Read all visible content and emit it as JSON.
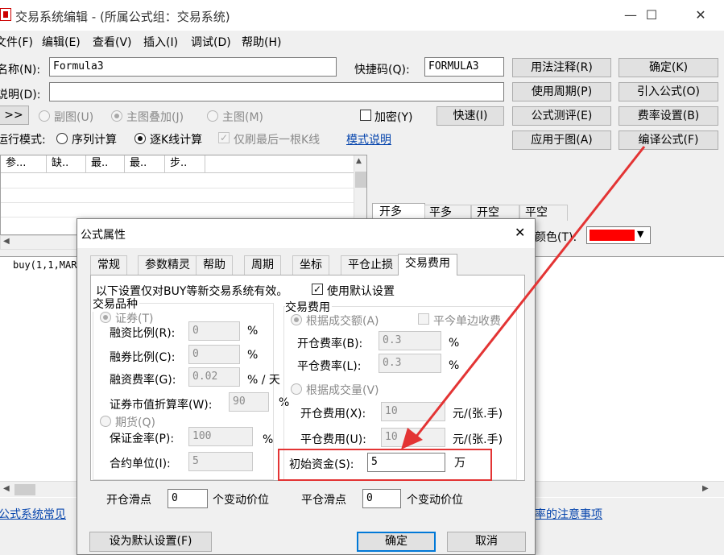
{
  "window": {
    "title": "交易系统编辑 - (所属公式组：交易系统)",
    "minimize": "—",
    "maximize": "☐",
    "close": "✕"
  },
  "menu": [
    "文件(F)",
    "编辑(E)",
    "查看(V)",
    "插入(I)",
    "调试(D)",
    "帮助(H)"
  ],
  "form": {
    "name_label": "名称(N):",
    "name_value": "Formula3",
    "shortcut_label": "快捷码(Q):",
    "shortcut_value": "FORMULA3",
    "desc_label": "说明(D):",
    "desc_value": "",
    "expand_btn": ">>",
    "sub_chart": "副图(U)",
    "main_overlay": "主图叠加(J)",
    "main_chart": "主图(M)",
    "encrypt": "加密(Y)",
    "quick_btn": "快速(I)",
    "run_mode_label": "运行模式:",
    "mode_seq": "序列计算",
    "mode_kline": "逐K线计算",
    "mode_last": "仅刷最后一根K线",
    "mode_help_link": "模式说明"
  },
  "side_buttons": {
    "usage_notes": "用法注释(R)",
    "ok": "确定(K)",
    "usage_period": "使用周期(P)",
    "import_formula": "引入公式(O)",
    "formula_eval": "公式测评(E)",
    "fee_settings": "费率设置(B)",
    "apply_chart": "应用于图(A)",
    "compile": "编译公式(F)"
  },
  "param_grid": {
    "columns": [
      "参...",
      "缺..",
      "最..",
      "最..",
      "步.."
    ]
  },
  "signal_tabs": [
    "开多",
    "平多",
    "开空",
    "平空"
  ],
  "color_label": "颜色(T):",
  "color_value": "#ff0000",
  "editor": {
    "code": "buy(1,1,MAR"
  },
  "bottom_links": {
    "left": "公式系统常见",
    "right": "率的注意事项"
  },
  "dialog": {
    "title": "公式属性",
    "close": "✕",
    "tabs": [
      "常规",
      "参数精灵",
      "帮助",
      "周期",
      "坐标",
      "平仓止损",
      "交易费用"
    ],
    "active_tab": "交易费用",
    "note": "以下设置仅对BUY等新交易系统有效。",
    "use_default": "使用默认设置",
    "product_group": "交易品种",
    "securities": "证券(T)",
    "margin_ratio_label": "融资比例(R):",
    "margin_ratio_value": "0",
    "short_ratio_label": "融券比例(C):",
    "short_ratio_value": "0",
    "margin_rate_label": "融资费率(G):",
    "margin_rate_value": "0.02",
    "pct": "%",
    "pct_per_day": "% / 天",
    "discount_label": "证券市值折算率(W):",
    "discount_value": "90",
    "futures": "期货(Q)",
    "deposit_label": "保证金率(P):",
    "deposit_value": "100",
    "contract_unit_label": "合约单位(I):",
    "contract_unit_value": "5",
    "fee_group": "交易费用",
    "by_amount": "根据成交额(A)",
    "close_today_single": "平今单边收费",
    "open_rate_label": "开仓费率(B):",
    "open_rate_value": "0.3",
    "close_rate_label": "平仓费率(L):",
    "close_rate_value": "0.3",
    "by_volume": "根据成交量(V)",
    "open_fee_label": "开仓费用(X):",
    "open_fee_value": "10",
    "close_fee_label": "平仓费用(U):",
    "close_fee_value": "10",
    "fee_unit": "元/(张.手)",
    "initial_capital_label": "初始资金(S):",
    "initial_capital_value": "5",
    "initial_capital_unit": "万",
    "open_slip_label": "开仓滑点",
    "open_slip_value": "0",
    "close_slip_label": "平仓滑点",
    "close_slip_value": "0",
    "tick_unit": "个变动价位",
    "set_default_btn": "设为默认设置(F)",
    "ok_btn": "确定",
    "cancel_btn": "取消"
  },
  "annotation_color": "#e33434"
}
